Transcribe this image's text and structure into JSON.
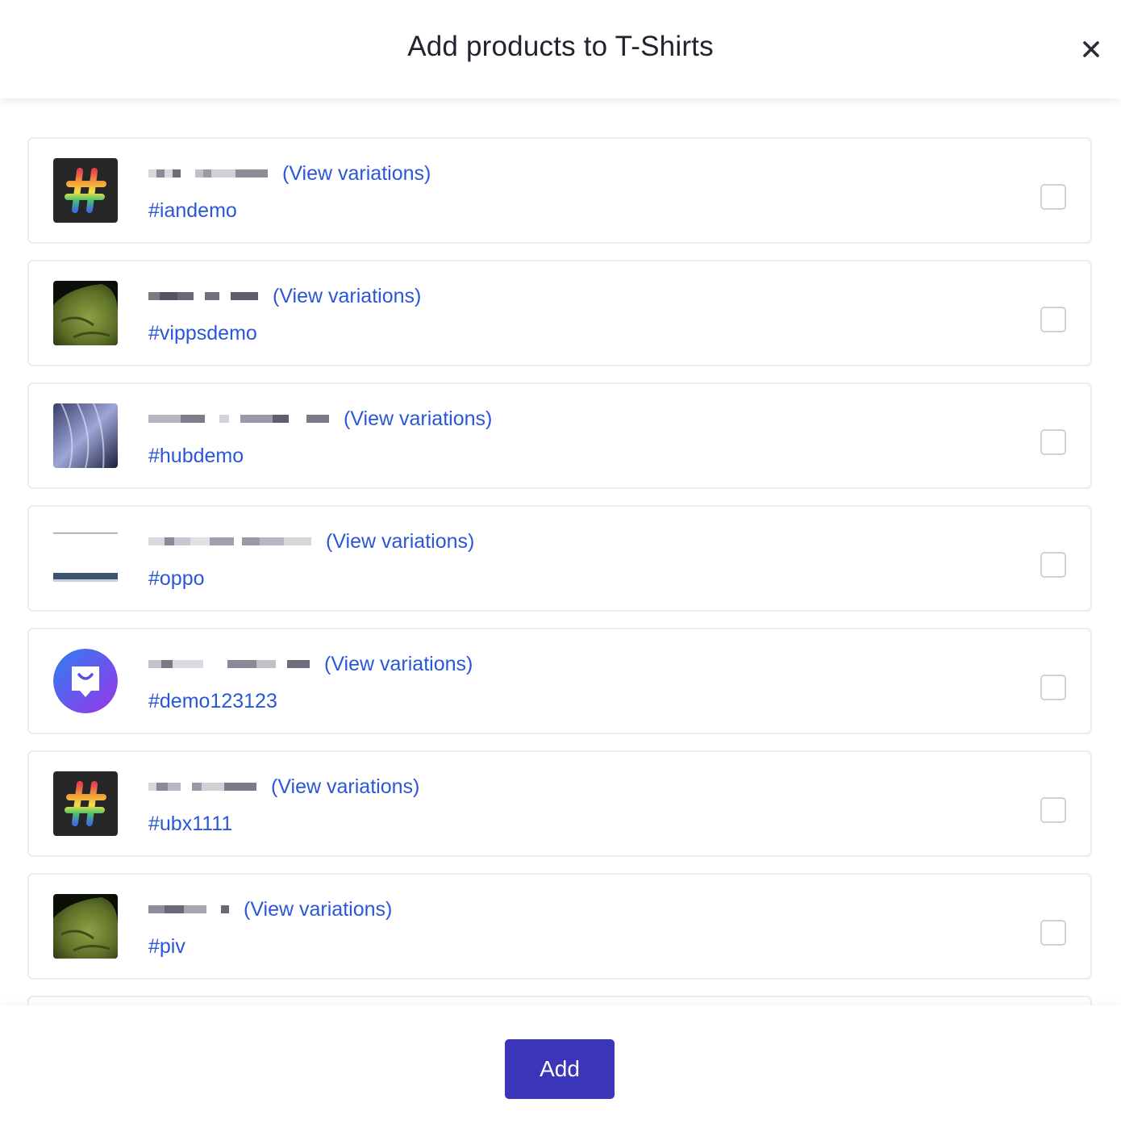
{
  "modal": {
    "title": "Add products to T-Shirts",
    "close_icon": "close-icon",
    "add_label": "Add"
  },
  "colors": {
    "link": "#2a57d8",
    "button": "#3a35b9",
    "border": "#ececef"
  },
  "products": [
    {
      "thumb": "hashtag-logo",
      "variations_label": "(View variations)",
      "handle": "#iandemo",
      "checked": false
    },
    {
      "thumb": "green-texture",
      "variations_label": "(View variations)",
      "handle": "#vippsdemo",
      "checked": false
    },
    {
      "thumb": "blue-hair-texture",
      "variations_label": "(View variations)",
      "handle": "#hubdemo",
      "checked": false
    },
    {
      "thumb": "phone-lines",
      "variations_label": "(View variations)",
      "handle": "#oppo",
      "checked": false
    },
    {
      "thumb": "shopping-bag-icon",
      "variations_label": "(View variations)",
      "handle": "#demo123123",
      "checked": false
    },
    {
      "thumb": "hashtag-logo",
      "variations_label": "(View variations)",
      "handle": "#ubx1111",
      "checked": false
    },
    {
      "thumb": "green-texture",
      "variations_label": "(View variations)",
      "handle": "#piv",
      "checked": false
    }
  ]
}
